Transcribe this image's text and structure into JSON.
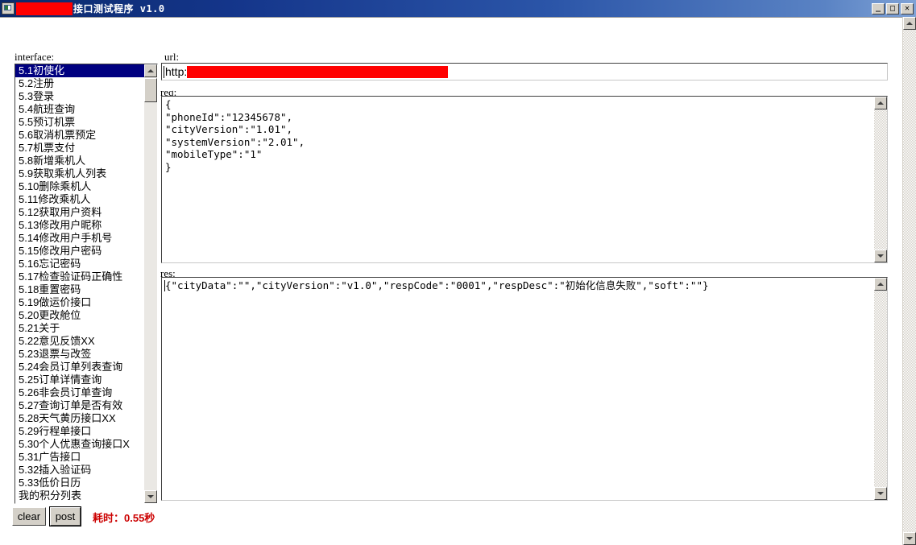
{
  "window": {
    "title": "接口测试程序 v1.0",
    "icon": "app-window-icon",
    "title_redacted": true,
    "minimize_label": "_",
    "maximize_label": "□",
    "close_label": "✕"
  },
  "labels": {
    "interface": "interface:",
    "url": "url:",
    "req": "req:",
    "res": "res:"
  },
  "interface_list": {
    "selected_index": 0,
    "items": [
      "5.1初使化",
      "5.2注册",
      "5.3登录",
      "5.4航班查询",
      "5.5预订机票",
      "5.6取消机票预定",
      "5.7机票支付",
      "5.8新增乘机人",
      "5.9获取乘机人列表",
      "5.10删除乘机人",
      "5.11修改乘机人",
      "5.12获取用户资料",
      "5.13修改用户昵称",
      "5.14修改用户手机号",
      "5.15修改用户密码",
      "5.16忘记密码",
      "5.17检查验证码正确性",
      "5.18重置密码",
      "5.19做运价接口",
      "5.20更改舱位",
      "5.21关于",
      "5.22意见反馈XX",
      "5.23退票与改签",
      "5.24会员订单列表查询",
      "5.25订单详情查询",
      "5.26非会员订单查询",
      "5.27查询订单是否有效",
      "5.28天气黄历接口XX",
      "5.29行程单接口",
      "5.30个人优惠查询接口X",
      "5.31广告接口",
      "5.32插入验证码",
      "5.33低价日历",
      "我的积分列表"
    ]
  },
  "url_field": {
    "value": "http:",
    "redacted": true,
    "redaction_color": "#ff0000"
  },
  "request": {
    "body": "{\n\"phoneId\":\"12345678\",\n\"cityVersion\":\"1.01\",\n\"systemVersion\":\"2.01\",\n\"mobileType\":\"1\"\n}"
  },
  "response": {
    "body": "{\"cityData\":\"\",\"cityVersion\":\"v1.0\",\"respCode\":\"0001\",\"respDesc\":\"初始化信息失败\",\"soft\":\"\"}"
  },
  "actions": {
    "clear_label": "clear",
    "post_label": "post",
    "elapsed_text": "耗时：0.55秒",
    "elapsed_color": "#cc0000"
  }
}
